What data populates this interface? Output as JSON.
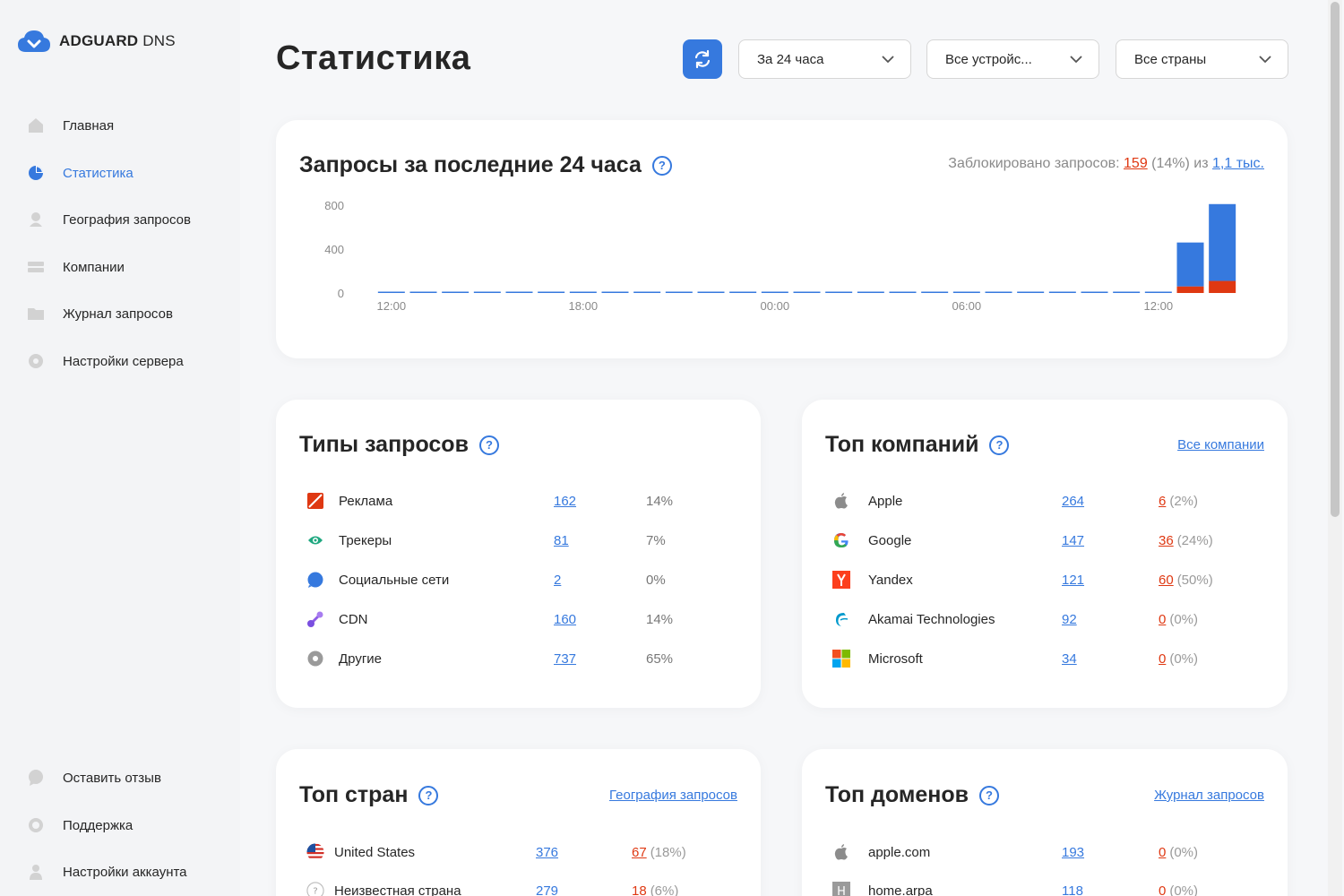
{
  "app": {
    "brand_bold": "ADGUARD",
    "brand_light": "DNS"
  },
  "sidebar": {
    "items": [
      {
        "label": "Главная",
        "icon": "home-icon"
      },
      {
        "label": "Статистика",
        "icon": "pie-chart-icon",
        "active": true
      },
      {
        "label": "География запросов",
        "icon": "location-pin-icon"
      },
      {
        "label": "Компании",
        "icon": "companies-icon"
      },
      {
        "label": "Журнал запросов",
        "icon": "folder-icon"
      },
      {
        "label": "Настройки сервера",
        "icon": "gear-icon"
      }
    ],
    "bottom_items": [
      {
        "label": "Оставить отзыв",
        "icon": "chat-bubble-icon"
      },
      {
        "label": "Поддержка",
        "icon": "support-icon"
      },
      {
        "label": "Настройки аккаунта",
        "icon": "user-icon"
      }
    ]
  },
  "header": {
    "title": "Статистика",
    "period": "За 24 часа",
    "devices": "Все устройс...",
    "countries": "Все страны"
  },
  "requests_card": {
    "title": "Запросы за последние 24 часа",
    "blocked_label": "Заблокировано запросов:",
    "blocked_count": "159",
    "blocked_pct": "(14%) из",
    "total": "1,1 тыс."
  },
  "chart_data": {
    "type": "bar",
    "stacked": true,
    "y_ticks": [
      "800",
      "400",
      "0"
    ],
    "ylim": [
      0,
      800
    ],
    "x_ticks": [
      "12:00",
      "18:00",
      "00:00",
      "06:00",
      "12:00"
    ],
    "series": [
      {
        "name": "",
        "color": "#df3812",
        "values": [
          0,
          0,
          0,
          0,
          0,
          0,
          0,
          0,
          0,
          0,
          0,
          0,
          0,
          0,
          0,
          0,
          0,
          0,
          0,
          0,
          0,
          0,
          0,
          0,
          0,
          60,
          110
        ]
      },
      {
        "name": "",
        "color": "#3679de",
        "values": [
          3,
          3,
          3,
          3,
          3,
          3,
          3,
          3,
          3,
          3,
          3,
          3,
          3,
          3,
          3,
          3,
          3,
          3,
          3,
          3,
          3,
          3,
          3,
          3,
          3,
          400,
          700
        ]
      }
    ]
  },
  "types_card": {
    "title": "Типы запросов",
    "rows": [
      {
        "name": "Реклама",
        "count": "162",
        "pct": "14%",
        "icon": "ads-icon"
      },
      {
        "name": "Трекеры",
        "count": "81",
        "pct": "7%",
        "icon": "eye-icon"
      },
      {
        "name": "Социальные сети",
        "count": "2",
        "pct": "0%",
        "icon": "social-icon"
      },
      {
        "name": "CDN",
        "count": "160",
        "pct": "14%",
        "icon": "cdn-icon"
      },
      {
        "name": "Другие",
        "count": "737",
        "pct": "65%",
        "icon": "other-icon"
      }
    ]
  },
  "companies_card": {
    "title": "Топ компаний",
    "link": "Все компании",
    "rows": [
      {
        "name": "Apple",
        "count": "264",
        "blocked": "6",
        "blocked_pct": "(2%)",
        "icon": "apple-icon"
      },
      {
        "name": "Google",
        "count": "147",
        "blocked": "36",
        "blocked_pct": "(24%)",
        "icon": "google-icon"
      },
      {
        "name": "Yandex",
        "count": "121",
        "blocked": "60",
        "blocked_pct": "(50%)",
        "icon": "yandex-icon"
      },
      {
        "name": "Akamai Technologies",
        "count": "92",
        "blocked": "0",
        "blocked_pct": "(0%)",
        "icon": "akamai-icon"
      },
      {
        "name": "Microsoft",
        "count": "34",
        "blocked": "0",
        "blocked_pct": "(0%)",
        "icon": "microsoft-icon"
      }
    ]
  },
  "countries_card": {
    "title": "Топ стран",
    "link": "География запросов",
    "rows": [
      {
        "name": "United States",
        "count": "376",
        "blocked": "67",
        "blocked_pct": "(18%)",
        "icon": "us-flag-icon"
      },
      {
        "name": "Неизвестная страна",
        "count": "279",
        "blocked": "18",
        "blocked_pct": "(6%)",
        "icon": "question-icon"
      }
    ]
  },
  "domains_card": {
    "title": "Топ доменов",
    "link": "Журнал запросов",
    "rows": [
      {
        "name": "apple.com",
        "count": "193",
        "blocked": "0",
        "blocked_pct": "(0%)",
        "icon": "apple-icon"
      },
      {
        "name": "home.arpa",
        "count": "118",
        "blocked": "0",
        "blocked_pct": "(0%)",
        "icon": "letter-h-icon"
      }
    ]
  }
}
